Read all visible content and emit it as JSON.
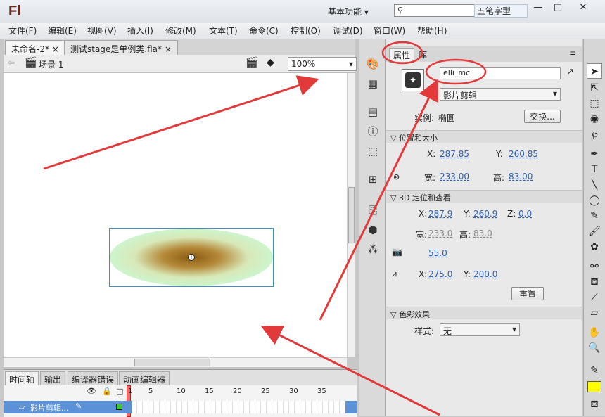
{
  "app": {
    "logo": "Fl",
    "workspace": "基本功能",
    "ime_label": "五笔字型"
  },
  "menu": [
    "文件(F)",
    "编辑(E)",
    "视图(V)",
    "插入(I)",
    "修改(M)",
    "文本(T)",
    "命令(C)",
    "控制(O)",
    "调试(D)",
    "窗口(W)",
    "帮助(H)"
  ],
  "doc_tabs": [
    "未命名-2*",
    "测试stage是单例类.fla*"
  ],
  "scene": {
    "label": "场景 1",
    "zoom": "100%"
  },
  "timeline": {
    "tabs": [
      "时间轴",
      "输出",
      "编译器错误",
      "动画编辑器"
    ],
    "frame_numbers": [
      "1",
      "5",
      "10",
      "15",
      "20",
      "25",
      "30",
      "35"
    ],
    "layer_name": "影片剪辑..."
  },
  "properties": {
    "tabs": [
      "属性",
      "库"
    ],
    "instance_name": "elli_mc",
    "symbol_type": "影片剪辑",
    "instance_label": "实例:",
    "instance_value": "椭圆",
    "swap_button": "交换...",
    "position_section": "位置和大小",
    "x_label": "X:",
    "x": "287.85",
    "y_label": "Y:",
    "y": "260.85",
    "w_label": "宽:",
    "w": "233.00",
    "h_label": "高:",
    "h": "83.00",
    "section_3d": "3D 定位和查看",
    "x3d": "287.9",
    "y3d": "260.9",
    "z_label": "Z:",
    "z3d": "0.0",
    "w3d": "233.0",
    "h3d": "83.0",
    "perspective": "55.0",
    "vp_x": "275.0",
    "vp_y": "200.0",
    "reset_button": "重置",
    "color_section": "色彩效果",
    "style_label": "样式:",
    "style_value": "无"
  },
  "colors": {
    "ellipse_center": "#8b5a10",
    "ellipse_edge": "#cdf5cd",
    "selection": "#3a8fd0",
    "annotation": "#e23a3a",
    "fill_swatch": "#ffff00"
  }
}
